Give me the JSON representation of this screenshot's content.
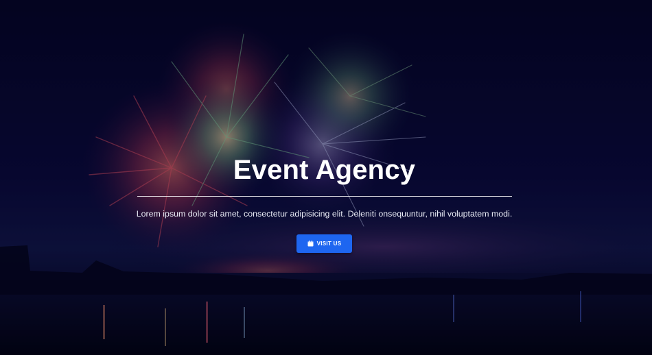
{
  "hero": {
    "title": "Event Agency",
    "subtitle": "Lorem ipsum dolor sit amet, consectetur adipisicing elit. Deleniti onsequuntur, nihil voluptatem modi.",
    "button": {
      "label": "VISIT US",
      "icon": "calendar-icon"
    }
  },
  "colors": {
    "button": "#1e66f0",
    "title": "#ffffff",
    "background": "#050622"
  }
}
